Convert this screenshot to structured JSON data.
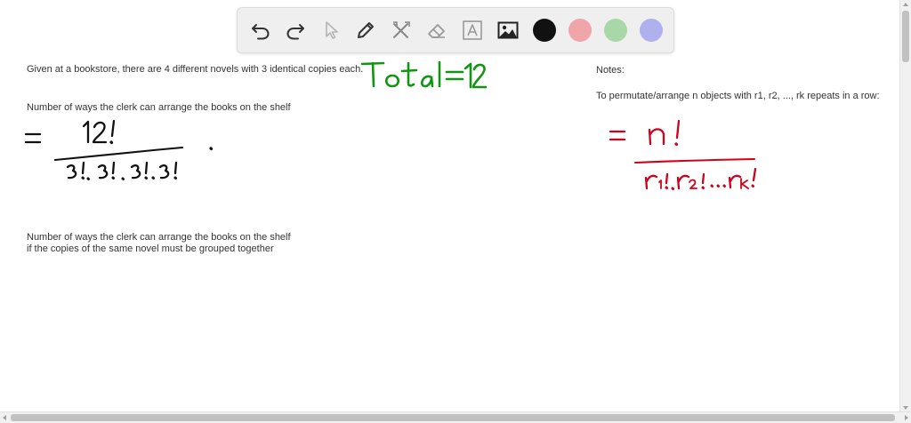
{
  "toolbar": {
    "tools": [
      {
        "name": "undo-icon"
      },
      {
        "name": "redo-icon"
      },
      {
        "name": "select-pointer-icon"
      },
      {
        "name": "pen-icon"
      },
      {
        "name": "shapes-tools-icon"
      },
      {
        "name": "eraser-icon"
      },
      {
        "name": "text-tool-icon"
      },
      {
        "name": "image-insert-icon"
      }
    ],
    "colors": [
      "#111111",
      "#f0a5a8",
      "#a8d8a8",
      "#b0b0ee"
    ],
    "accent_colors": {
      "red_ink": "#d0021b",
      "green_ink": "#139413",
      "black_ink": "#111111"
    }
  },
  "content": {
    "problem_intro": "Given at a bookstore, there are 4 different novels with 3 identical copies each.",
    "question_1": "Number of ways the clerk can arrange the books on the shelf",
    "question_2_line_1": "Number of ways the clerk can arrange the books on the shelf",
    "question_2_line_2": "if the copies of the same novel must be grouped together",
    "notes_title": "Notes:",
    "notes_text": "To permutate/arrange n objects with r1, r2, ..., rk repeats in a row:"
  }
}
